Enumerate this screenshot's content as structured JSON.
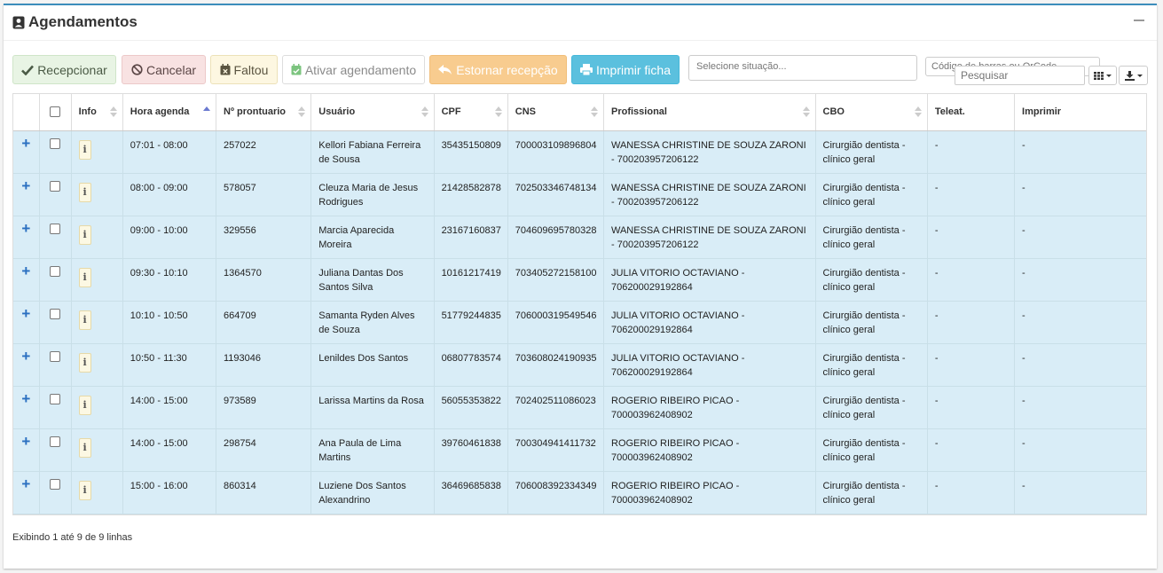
{
  "panel": {
    "title": "Agendamentos"
  },
  "toolbar": {
    "recepcionar": "Recepcionar",
    "cancelar": "Cancelar",
    "faltou": "Faltou",
    "ativar": "Ativar agendamento",
    "estornar": "Estornar recepção",
    "imprimir": "Imprimir ficha",
    "situacao_placeholder": "Selecione situação...",
    "barcode_placeholder": "Código de barras ou QrCode",
    "search_placeholder": "Pesquisar"
  },
  "colors": {
    "panel_border": "#3c8dbc",
    "row_bg": "#d9edf7",
    "plus": "#2a6fc0",
    "info_btn": "#5bc0de",
    "warning_btn": "#f8cc8f"
  },
  "table": {
    "headers": {
      "info": "Info",
      "hora": "Hora agenda",
      "prontuario": "Nº prontuario",
      "usuario": "Usuário",
      "cpf": "CPF",
      "cns": "CNS",
      "profissional": "Profissional",
      "cbo": "CBO",
      "teleat": "Teleat.",
      "imprimir": "Imprimir"
    },
    "rows": [
      {
        "hora": "07:01 - 08:00",
        "prontuario": "257022",
        "usuario": "Kellori Fabiana Ferreira de Sousa",
        "cpf": "35435150809",
        "cns": "700003109896804",
        "profissional": "WANESSA CHRISTINE DE SOUZA ZARONI - 700203957206122",
        "cbo": "Cirurgião dentista - clínico geral",
        "teleat": "-",
        "imprimir": "-"
      },
      {
        "hora": "08:00 - 09:00",
        "prontuario": "578057",
        "usuario": "Cleuza Maria de Jesus Rodrigues",
        "cpf": "21428582878",
        "cns": "702503346748134",
        "profissional": "WANESSA CHRISTINE DE SOUZA ZARONI - 700203957206122",
        "cbo": "Cirurgião dentista - clínico geral",
        "teleat": "-",
        "imprimir": "-"
      },
      {
        "hora": "09:00 - 10:00",
        "prontuario": "329556",
        "usuario": "Marcia Aparecida Moreira",
        "cpf": "23167160837",
        "cns": "704609695780328",
        "profissional": "WANESSA CHRISTINE DE SOUZA ZARONI - 700203957206122",
        "cbo": "Cirurgião dentista - clínico geral",
        "teleat": "-",
        "imprimir": "-"
      },
      {
        "hora": "09:30 - 10:10",
        "prontuario": "1364570",
        "usuario": "Juliana Dantas Dos Santos Silva",
        "cpf": "10161217419",
        "cns": "703405272158100",
        "profissional": "JULIA VITORIO OCTAVIANO - 706200029192864",
        "cbo": "Cirurgião dentista - clínico geral",
        "teleat": "-",
        "imprimir": "-"
      },
      {
        "hora": "10:10 - 10:50",
        "prontuario": "664709",
        "usuario": "Samanta Ryden Alves de Souza",
        "cpf": "51779244835",
        "cns": "706000319549546",
        "profissional": "JULIA VITORIO OCTAVIANO - 706200029192864",
        "cbo": "Cirurgião dentista - clínico geral",
        "teleat": "-",
        "imprimir": "-"
      },
      {
        "hora": "10:50 - 11:30",
        "prontuario": "1193046",
        "usuario": "Lenildes Dos Santos",
        "cpf": "06807783574",
        "cns": "703608024190935",
        "profissional": "JULIA VITORIO OCTAVIANO - 706200029192864",
        "cbo": "Cirurgião dentista - clínico geral",
        "teleat": "-",
        "imprimir": "-"
      },
      {
        "hora": "14:00 - 15:00",
        "prontuario": "973589",
        "usuario": "Larissa Martins da Rosa",
        "cpf": "56055353822",
        "cns": "702402511086023",
        "profissional": "ROGERIO RIBEIRO PICAO - 700003962408902",
        "cbo": "Cirurgião dentista - clínico geral",
        "teleat": "-",
        "imprimir": "-"
      },
      {
        "hora": "14:00 - 15:00",
        "prontuario": "298754",
        "usuario": "Ana Paula de Lima Martins",
        "cpf": "39760461838",
        "cns": "700304941411732",
        "profissional": "ROGERIO RIBEIRO PICAO - 700003962408902",
        "cbo": "Cirurgião dentista - clínico geral",
        "teleat": "-",
        "imprimir": "-"
      },
      {
        "hora": "15:00 - 16:00",
        "prontuario": "860314",
        "usuario": "Luziene Dos Santos Alexandrino",
        "cpf": "36469685838",
        "cns": "706008392334349",
        "profissional": "ROGERIO RIBEIRO PICAO - 700003962408902",
        "cbo": "Cirurgião dentista - clínico geral",
        "teleat": "-",
        "imprimir": "-"
      }
    ]
  },
  "footer": {
    "summary": "Exibindo 1 até 9 de 9 linhas"
  }
}
